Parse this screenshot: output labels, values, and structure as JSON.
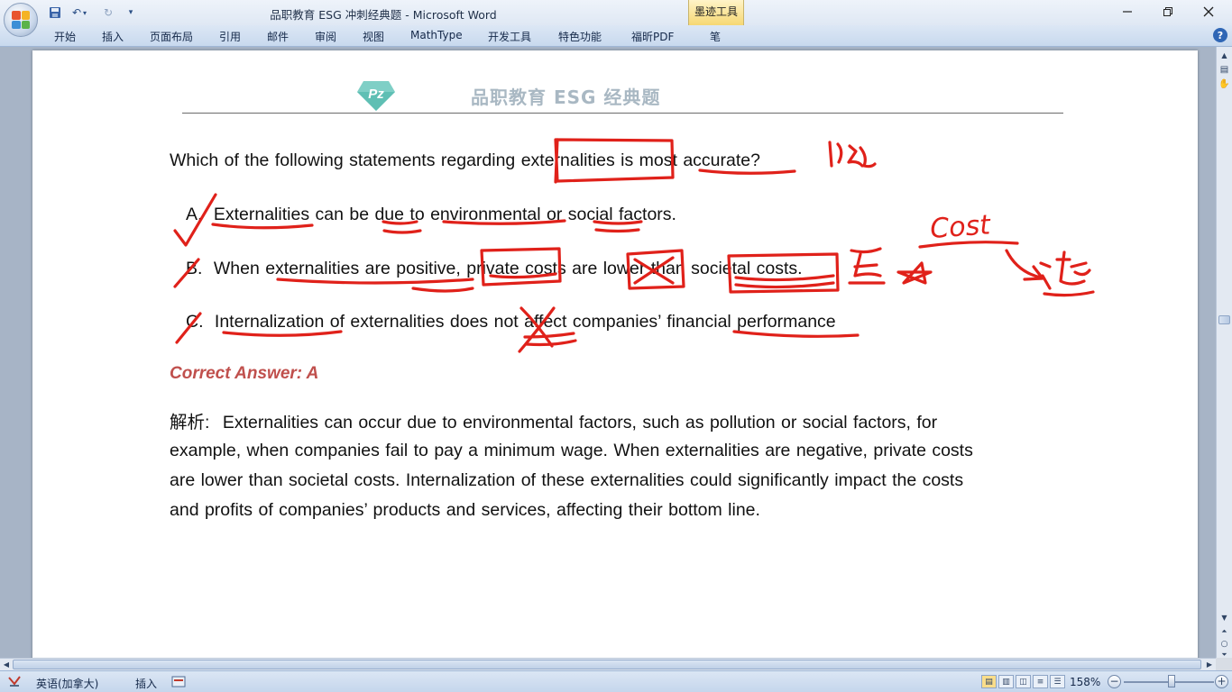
{
  "window": {
    "title": "品职教育 ESG 冲刺经典题 - Microsoft Word",
    "contextual_tab": "墨迹工具"
  },
  "ribbon": {
    "tabs": [
      "开始",
      "插入",
      "页面布局",
      "引用",
      "邮件",
      "审阅",
      "视图",
      "MathType",
      "开发工具",
      "特色功能",
      "福昕PDF",
      "笔"
    ]
  },
  "document": {
    "header_title": "品职教育 ESG 经典题",
    "question": "Which of the following statements regarding externalities is most accurate?",
    "options": [
      {
        "letter": "A.",
        "text": "Externalities can be due to environmental or social factors."
      },
      {
        "letter": "B.",
        "text": "When externalities are positive, private costs are lower than societal costs."
      },
      {
        "letter": "C.",
        "text": "Internalization of externalities does not affect companies’ financial performance"
      }
    ],
    "correct_answer": "Correct Answer: A",
    "explanation": {
      "label": "解析:",
      "line1": "Externalities can occur due to environmental factors, such as pollution or social factors, for",
      "line2": "example, when companies fail to pay a minimum wage. When externalities are negative, private costs",
      "line3": "are lower than societal costs. Internalization of these externalities could significantly impact the costs",
      "line4": "and profits of companies’ products and services, affecting their bottom line."
    },
    "ink_annotations": {
      "word_cost": "Cost",
      "ink_color": "#e0211a"
    }
  },
  "statusbar": {
    "language": "英语(加拿大)",
    "insert_mode": "插入",
    "zoom": "158%"
  },
  "colors": {
    "answer": "#c0504d",
    "header_title": "#a9b8c3",
    "logo": "#7fcfc6"
  }
}
